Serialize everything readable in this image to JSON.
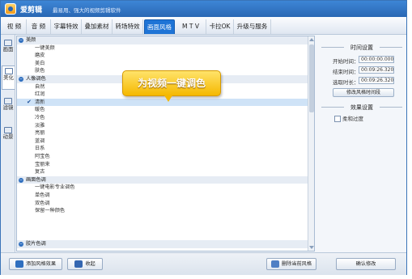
{
  "app": {
    "name": "爱剪辑",
    "tagline": "最易用、强大的视频剪辑软件"
  },
  "tabs": [
    {
      "label": "视 频"
    },
    {
      "label": "音 频"
    },
    {
      "label": "字幕特效"
    },
    {
      "label": "叠加素材"
    },
    {
      "label": "转场特效"
    },
    {
      "label": "画面风格",
      "active": true
    },
    {
      "label": "M T V"
    },
    {
      "label": "卡拉OK"
    },
    {
      "label": "升级与服务"
    }
  ],
  "rail": [
    {
      "label": "画面",
      "icon": "picture-icon"
    },
    {
      "label": "美化",
      "icon": "magic-wand-icon",
      "active": true
    },
    {
      "label": "滤镜",
      "icon": "filter-icon"
    },
    {
      "label": "动景",
      "icon": "motion-icon"
    }
  ],
  "list": [
    {
      "type": "cat",
      "label": "美颜"
    },
    {
      "type": "item",
      "label": "一键美颜"
    },
    {
      "type": "item",
      "label": "磨皮"
    },
    {
      "type": "item",
      "label": "美白"
    },
    {
      "type": "item",
      "label": "肤色"
    },
    {
      "type": "cat",
      "label": "人像调色"
    },
    {
      "type": "item",
      "label": "自然"
    },
    {
      "type": "item",
      "label": "红润"
    },
    {
      "type": "item",
      "label": "清新",
      "selected": true
    },
    {
      "type": "item",
      "label": "暖色"
    },
    {
      "type": "item",
      "label": "冷色"
    },
    {
      "type": "item",
      "label": "淡雅"
    },
    {
      "type": "item",
      "label": "亮丽"
    },
    {
      "type": "item",
      "label": "蓝调"
    },
    {
      "type": "item",
      "label": "日系"
    },
    {
      "type": "item",
      "label": "阿宝色"
    },
    {
      "type": "item",
      "label": "宝丽来"
    },
    {
      "type": "item",
      "label": "复古"
    },
    {
      "type": "cat",
      "label": "画面色调"
    },
    {
      "type": "item",
      "label": "一键电影专业调色"
    },
    {
      "type": "item",
      "label": "单色调"
    },
    {
      "type": "item",
      "label": "双色调"
    },
    {
      "type": "item",
      "label": "保留一种颜色"
    },
    {
      "type": "cat",
      "label": "胶片色调"
    }
  ],
  "callout": {
    "text": "为视频一键调色"
  },
  "time_settings": {
    "title": "时间设置",
    "start_label": "开始时间：",
    "start_value": "00:00:00.000",
    "end_label": "结束时间：",
    "end_value": "00:09:26.320",
    "duration_label": "选取时长：",
    "duration_value": "00:09:26.320",
    "modify_button": "修改风格时间段"
  },
  "effect_settings": {
    "title": "效果设置",
    "soft_transition_label": "柔和过度"
  },
  "bottom": {
    "add_button": "添加风格效果",
    "collapse_button": "收起",
    "delete_button": "删除当前风格",
    "confirm_button": "确认修改"
  }
}
